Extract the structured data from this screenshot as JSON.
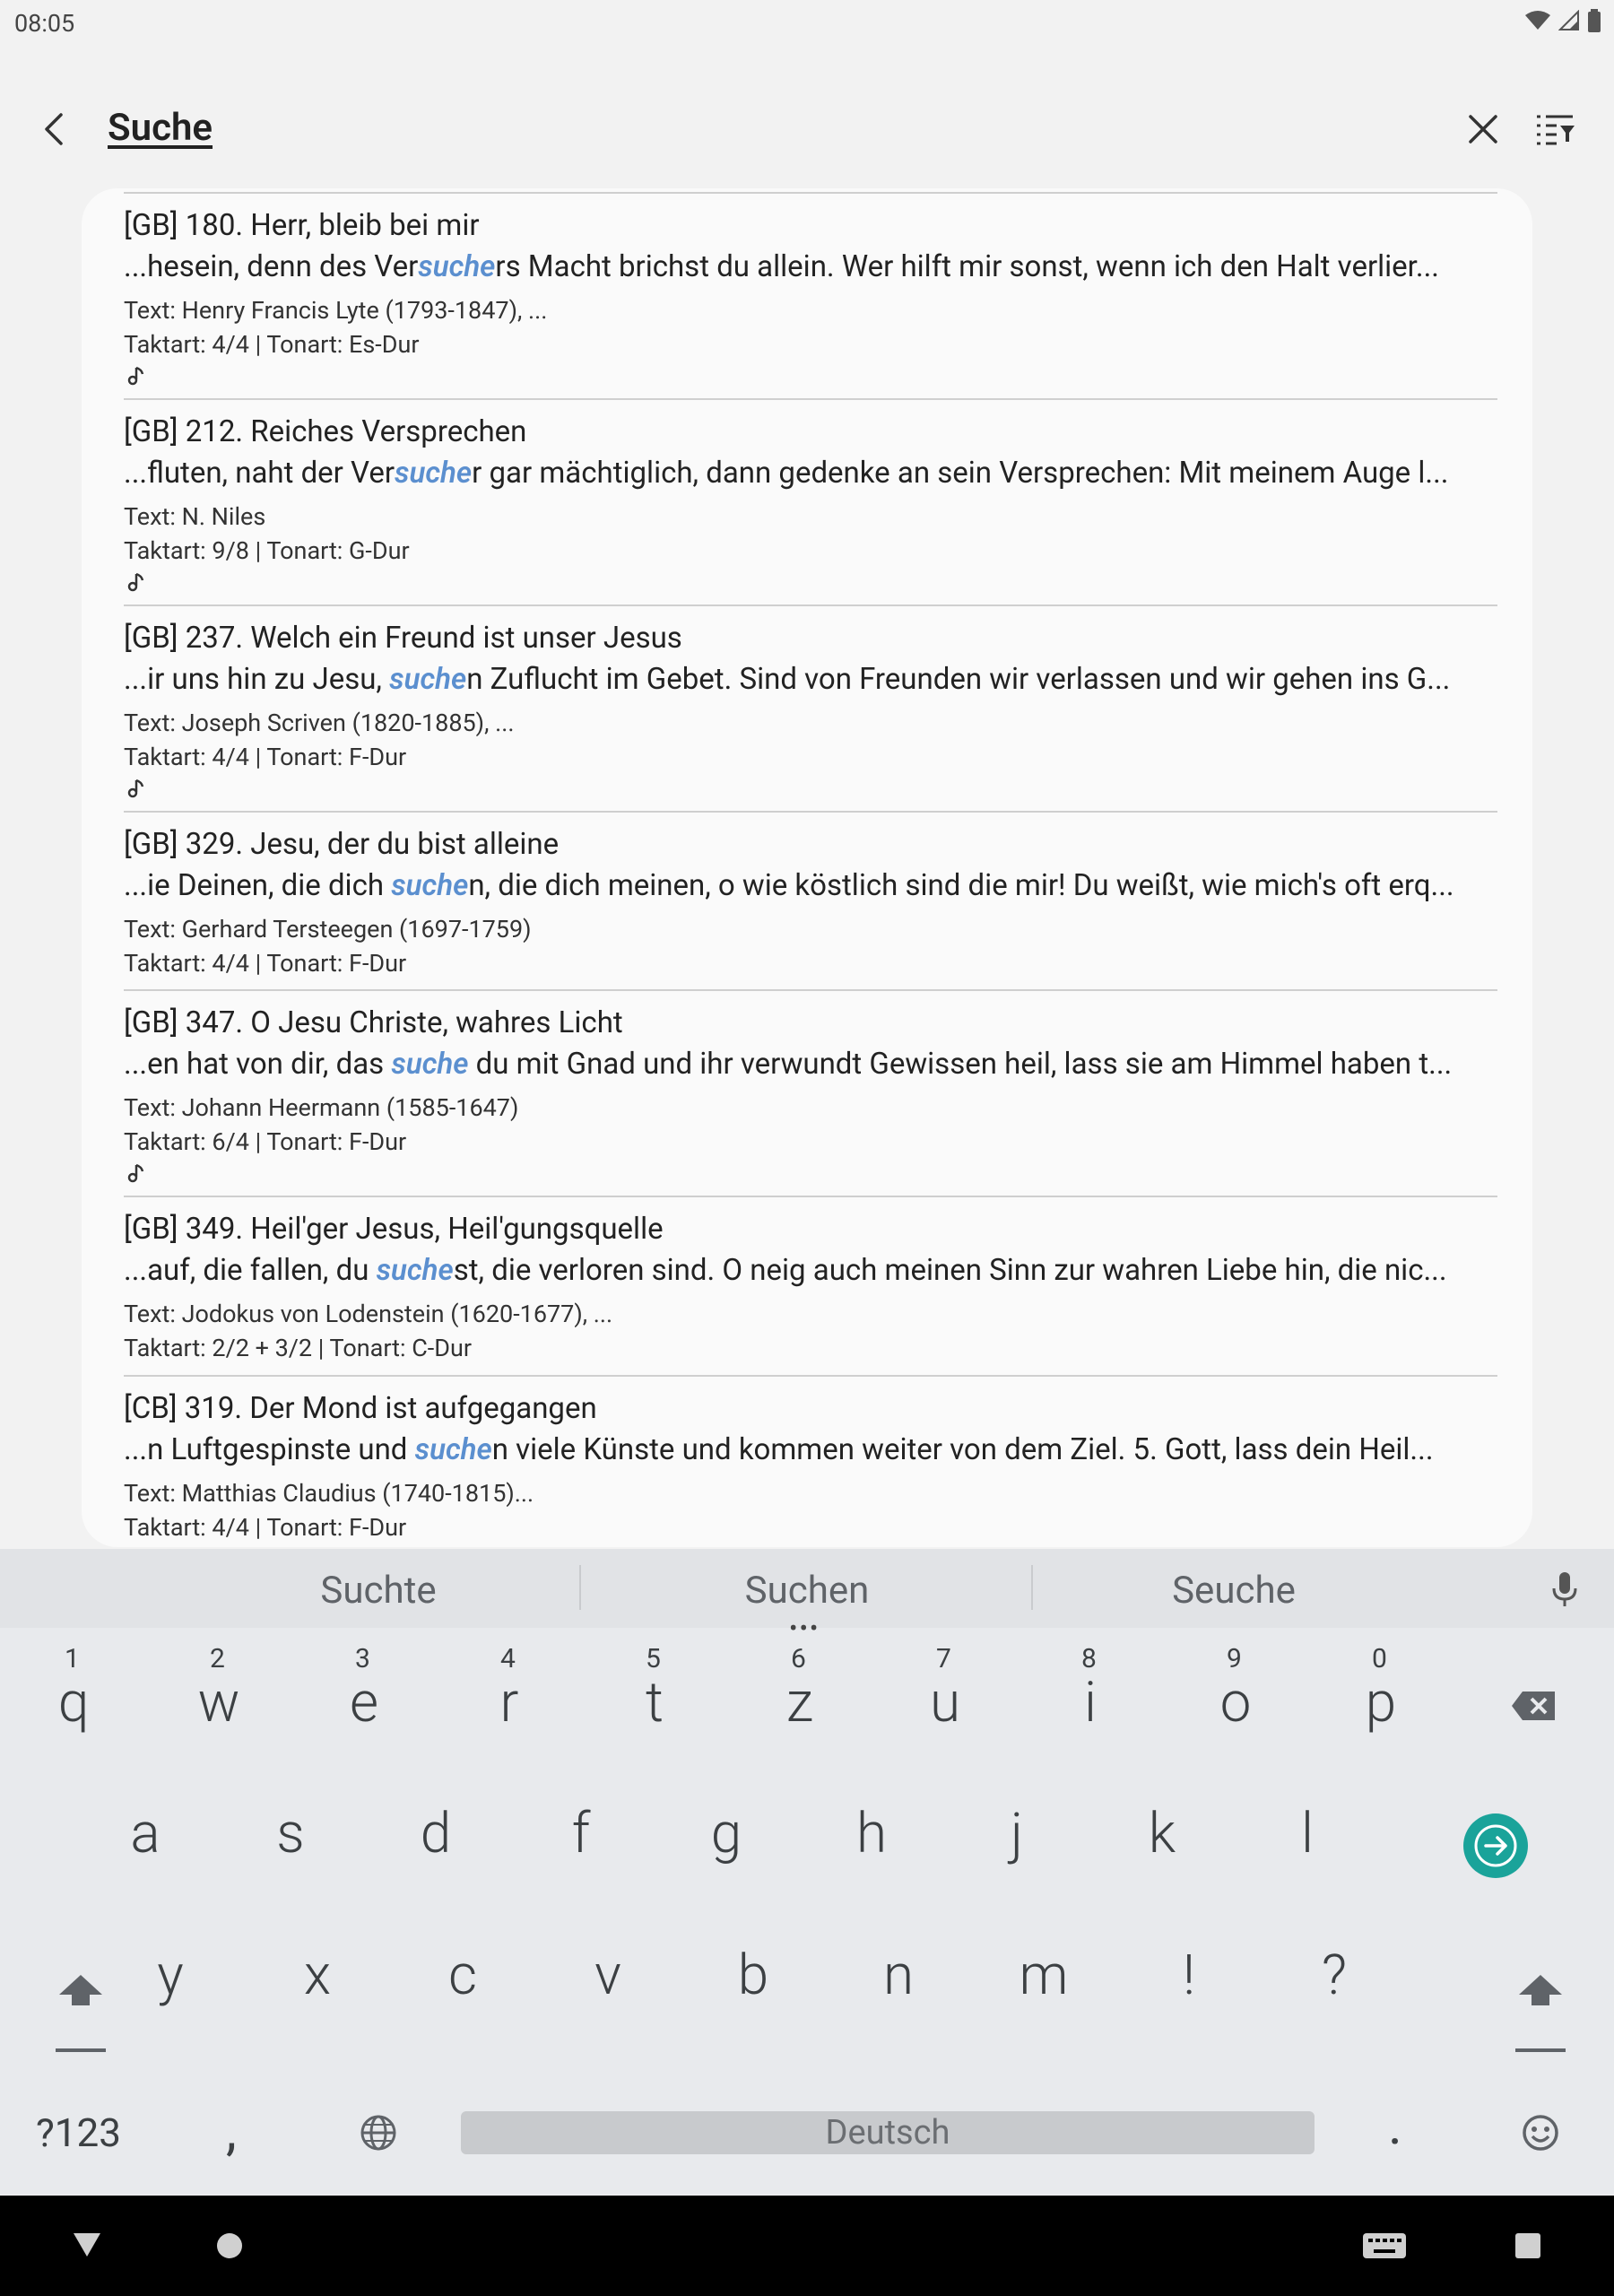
{
  "status_bar": {
    "time": "08:05"
  },
  "app_bar": {
    "title": "Suche"
  },
  "results": [
    {
      "title": "[GB] 180. Herr, bleib bei mir",
      "snippet_pre": "...hesein, denn des Ver",
      "snippet_hl": "suche",
      "snippet_post": "rs Macht brichst du allein. Wer hilft mir sonst, wenn ich den Halt verlier...",
      "author": "Text: Henry Francis Lyte (1793-1847), ...",
      "meta": "Taktart: 4/4  |  Tonart: Es-Dur",
      "has_audio": true
    },
    {
      "title": "[GB] 212. Reiches Versprechen",
      "snippet_pre": "...fluten, naht der Ver",
      "snippet_hl": "suche",
      "snippet_post": "r gar mächtiglich, dann gedenke an sein Versprechen: Mit meinem Auge l...",
      "author": "Text: N. Niles",
      "meta": "Taktart: 9/8  |  Tonart: G-Dur",
      "has_audio": true
    },
    {
      "title": "[GB] 237. Welch ein Freund ist unser Jesus",
      "snippet_pre": "...ir uns hin zu Jesu, ",
      "snippet_hl": "suche",
      "snippet_post": "n Zuflucht im Gebet. Sind von Freunden wir verlassen und wir gehen ins G...",
      "author": "Text: Joseph Scriven (1820-1885), ...",
      "meta": "Taktart: 4/4  |  Tonart: F-Dur",
      "has_audio": true
    },
    {
      "title": "[GB] 329. Jesu, der du bist alleine",
      "snippet_pre": "...ie Deinen, die dich ",
      "snippet_hl": "suche",
      "snippet_post": "n, die dich meinen, o wie köstlich sind die mir! Du weißt, wie mich's oft erq...",
      "author": "Text: Gerhard Tersteegen (1697-1759)",
      "meta": "Taktart: 4/4  |  Tonart: F-Dur",
      "has_audio": false
    },
    {
      "title": "[GB] 347. O Jesu Christe, wahres Licht",
      "snippet_pre": "...en hat von dir, das ",
      "snippet_hl": "suche",
      "snippet_post": " du mit Gnad und ihr verwundt Gewissen heil, lass sie am Himmel haben t...",
      "author": "Text: Johann Heermann (1585-1647)",
      "meta": "Taktart: 6/4  |  Tonart: F-Dur",
      "has_audio": true
    },
    {
      "title": "[GB] 349. Heil'ger Jesus, Heil'gungsquelle",
      "snippet_pre": "...auf, die fallen, du ",
      "snippet_hl": "suche",
      "snippet_post": "st, die verloren sind. O neig auch meinen Sinn zur wahren Liebe hin, die nic...",
      "author": "Text: Jodokus von Lodenstein (1620-1677), ...",
      "meta": "Taktart: 2/2 + 3/2  |  Tonart: C-Dur",
      "has_audio": false
    },
    {
      "title": "[CB] 319. Der Mond ist aufgegangen",
      "snippet_pre": "...n Luftgespinste und ",
      "snippet_hl": "suche",
      "snippet_post": "n viele Künste und kommen weiter von dem Ziel.    5. Gott, lass dein Heil...",
      "author": "Text: Matthias Claudius (1740-1815)...",
      "meta": "Taktart: 4/4  |  Tonart: F-Dur",
      "has_audio": false
    }
  ],
  "keyboard": {
    "suggestions": [
      "Suchte",
      "Suchen",
      "Seuche"
    ],
    "row1": [
      {
        "k": "q",
        "n": "1"
      },
      {
        "k": "w",
        "n": "2"
      },
      {
        "k": "e",
        "n": "3"
      },
      {
        "k": "r",
        "n": "4"
      },
      {
        "k": "t",
        "n": "5"
      },
      {
        "k": "z",
        "n": "6"
      },
      {
        "k": "u",
        "n": "7"
      },
      {
        "k": "i",
        "n": "8"
      },
      {
        "k": "o",
        "n": "9"
      },
      {
        "k": "p",
        "n": "0"
      }
    ],
    "row2": [
      "a",
      "s",
      "d",
      "f",
      "g",
      "h",
      "j",
      "k",
      "l"
    ],
    "row3": [
      "y",
      "x",
      "c",
      "v",
      "b",
      "n",
      "m",
      "!",
      "?"
    ],
    "symbols_label": "?123",
    "comma": ",",
    "period": ".",
    "space_label": "Deutsch"
  }
}
